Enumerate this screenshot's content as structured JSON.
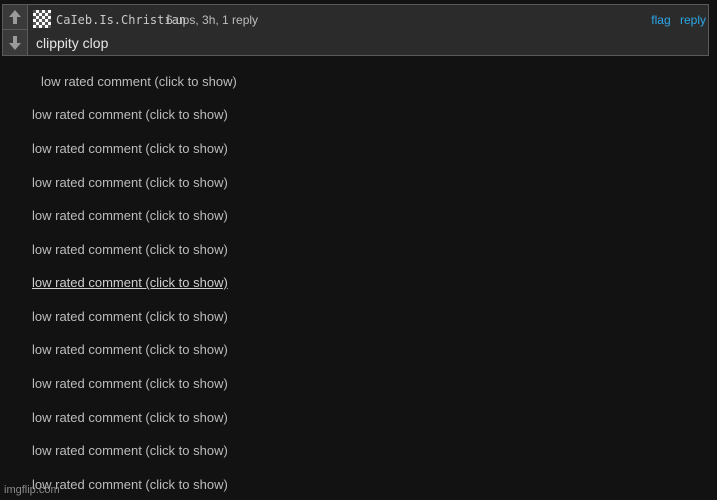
{
  "comment": {
    "username": "CaIeb.Is.Christian",
    "meta": "6 ups, 3h, 1 reply",
    "flag_label": "flag",
    "reply_label": "reply",
    "text": "clippity clop",
    "upvote_icon": "arrow-up-icon",
    "downvote_icon": "arrow-down-icon",
    "avatar_icon": "checkered-avatar-icon"
  },
  "hidden_comments": [
    {
      "label": "low rated comment (click to show)"
    },
    {
      "label": "low rated comment (click to show)"
    },
    {
      "label": "low rated comment (click to show)"
    },
    {
      "label": "low rated comment (click to show)"
    },
    {
      "label": "low rated comment (click to show)"
    },
    {
      "label": "low rated comment (click to show)"
    },
    {
      "label": "low rated comment (click to show)"
    },
    {
      "label": "low rated comment (click to show)"
    },
    {
      "label": "low rated comment (click to show)"
    },
    {
      "label": "low rated comment (click to show)"
    },
    {
      "label": "low rated comment (click to show)"
    },
    {
      "label": "low rated comment (click to show)"
    },
    {
      "label": "low rated comment (click to show)"
    }
  ],
  "watermark": "imgflip.com",
  "colors": {
    "link": "#2aa7e8",
    "background": "#121212",
    "panel": "#2b2b2b"
  }
}
